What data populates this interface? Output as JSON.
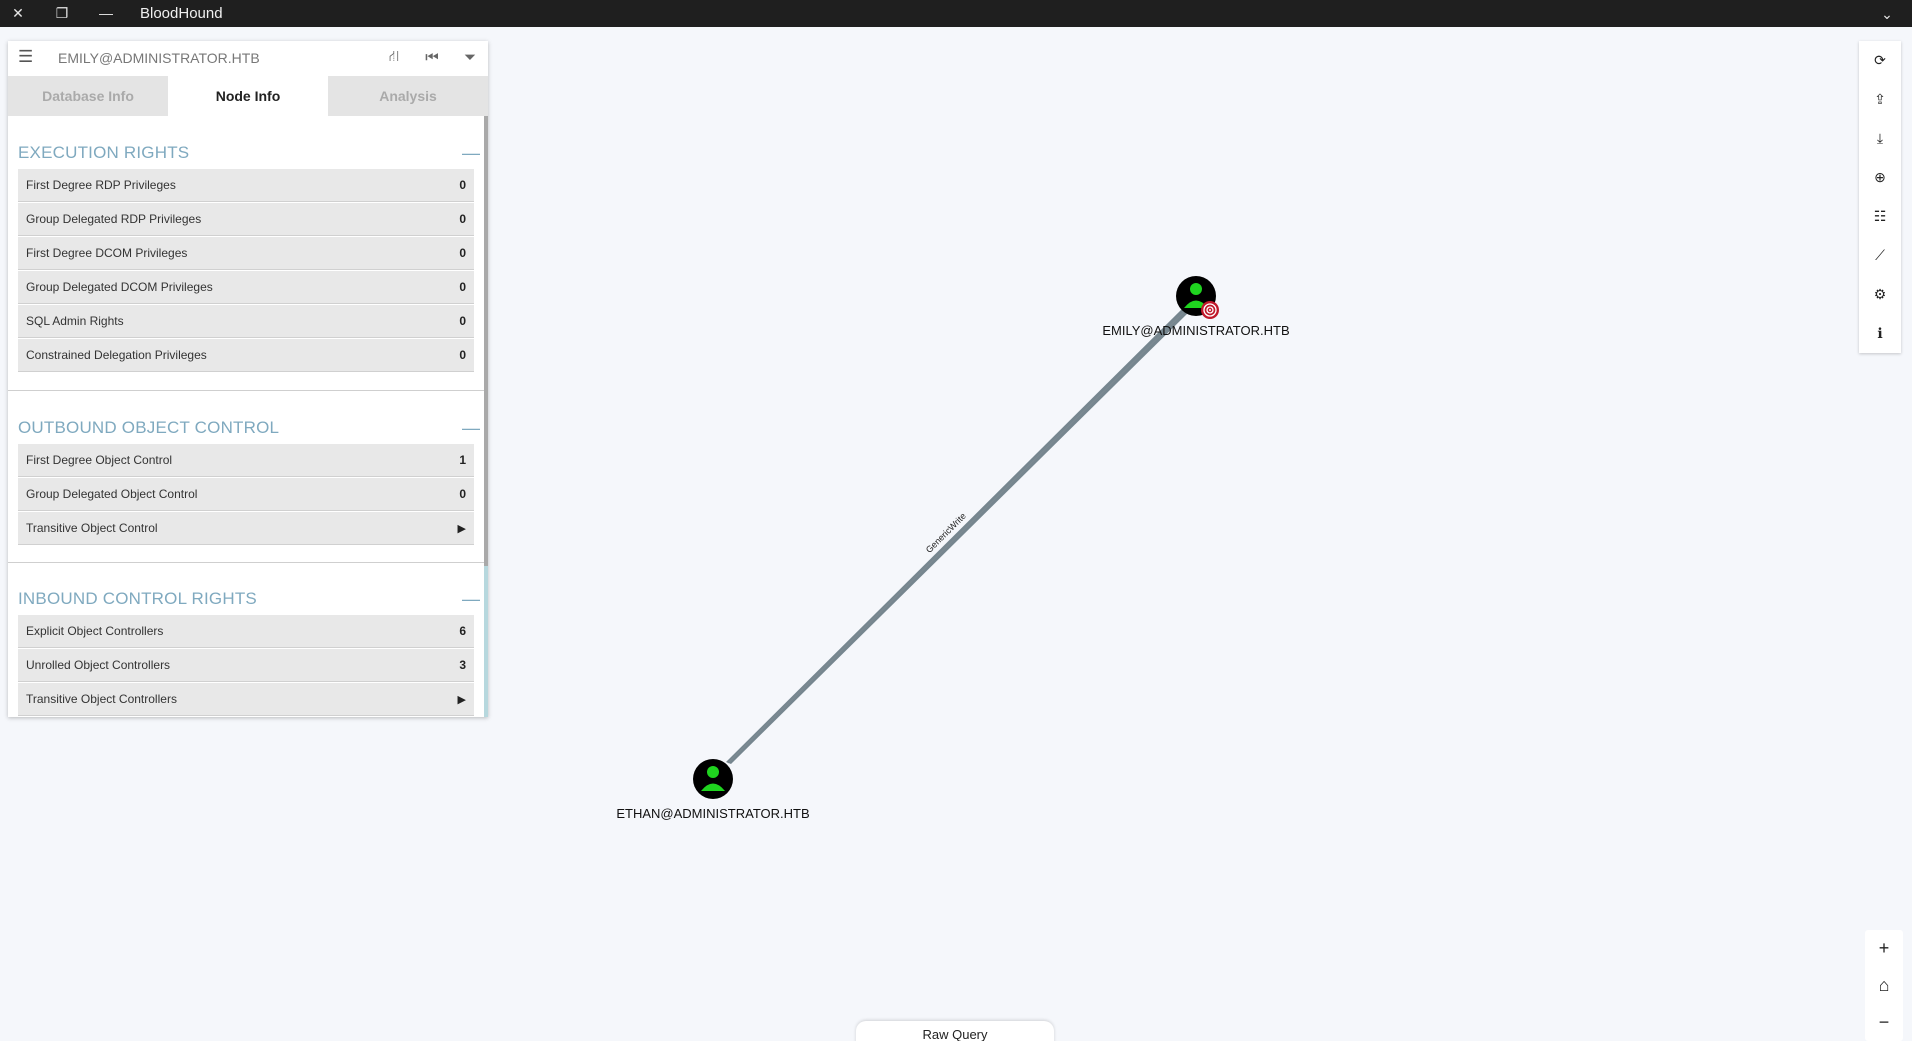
{
  "window": {
    "title": "BloodHound"
  },
  "search": {
    "value": "EMILY@ADMINISTRATOR.HTB"
  },
  "tabs": [
    {
      "label": "Database Info"
    },
    {
      "label": "Node Info",
      "active": true
    },
    {
      "label": "Analysis"
    }
  ],
  "sections": [
    {
      "title": "EXECUTION RIGHTS",
      "rows": [
        {
          "label": "First Degree RDP Privileges",
          "value": "0"
        },
        {
          "label": "Group Delegated RDP Privileges",
          "value": "0"
        },
        {
          "label": "First Degree DCOM Privileges",
          "value": "0"
        },
        {
          "label": "Group Delegated DCOM Privileges",
          "value": "0"
        },
        {
          "label": "SQL Admin Rights",
          "value": "0"
        },
        {
          "label": "Constrained Delegation Privileges",
          "value": "0"
        }
      ]
    },
    {
      "title": "OUTBOUND OBJECT CONTROL",
      "rows": [
        {
          "label": "First Degree Object Control",
          "value": "1"
        },
        {
          "label": "Group Delegated Object Control",
          "value": "0"
        },
        {
          "label": "Transitive Object Control",
          "value": "▶"
        }
      ]
    },
    {
      "title": "INBOUND CONTROL RIGHTS",
      "rows": [
        {
          "label": "Explicit Object Controllers",
          "value": "6"
        },
        {
          "label": "Unrolled Object Controllers",
          "value": "3"
        },
        {
          "label": "Transitive Object Controllers",
          "value": "▶"
        }
      ]
    }
  ],
  "graph": {
    "nodes": [
      {
        "label": "EMILY@ADMINISTRATOR.HTB",
        "type": "user",
        "owned_target": true
      },
      {
        "label": "ETHAN@ADMINISTRATOR.HTB",
        "type": "user"
      }
    ],
    "edges": [
      {
        "label": "GenericWrite"
      }
    ],
    "colors": {
      "node_fill": "#000000",
      "user_icon": "#1fd41f",
      "edge": "#6f8089",
      "target_badge": "#c0182a"
    }
  },
  "toolbar": {
    "icons": [
      "refresh-icon",
      "upload-icon",
      "download-icon",
      "upload-circle-icon",
      "list-icon",
      "chart-icon",
      "settings-icon",
      "info-icon"
    ]
  },
  "zoom": {
    "icons": [
      "zoom-in-icon",
      "home-icon",
      "zoom-out-icon"
    ]
  },
  "raw_query": {
    "label": "Raw Query"
  }
}
